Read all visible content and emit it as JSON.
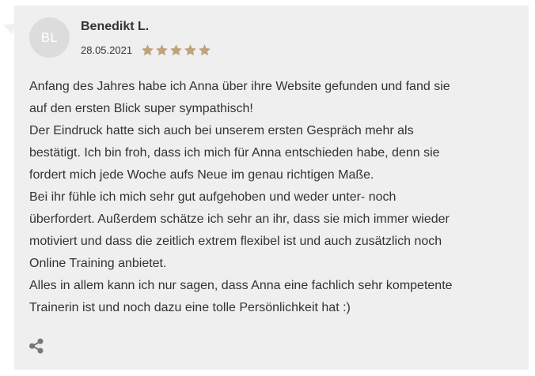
{
  "review": {
    "avatar_initials": "BL",
    "author": "Benedikt L.",
    "date": "28.05.2021",
    "rating": 5,
    "rating_max": 5,
    "star_color": "#bfa37a",
    "text": "Anfang des Jahres habe ich Anna über ihre Website gefunden und fand sie\nauf den ersten Blick super sympathisch!\nDer Eindruck hatte sich auch bei unserem ersten Gespräch mehr als\nbestätigt. Ich bin froh, dass ich mich für Anna entschieden habe, denn sie\nfordert mich jede Woche aufs Neue im genau richtigen Maße.\nBei ihr fühle ich mich sehr gut aufgehoben und weder unter- noch\nüberfordert. Außerdem schätze ich sehr an ihr, dass sie mich immer wieder\nmotiviert und dass die zeitlich extrem flexibel ist und auch zusätzlich noch\nOnline Training anbietet.\nAlles in allem kann ich nur sagen, dass Anna eine fachlich sehr kompetente\nTrainerin ist und noch dazu eine tolle Persönlichkeit hat :)",
    "share_icon": "share-icon"
  }
}
